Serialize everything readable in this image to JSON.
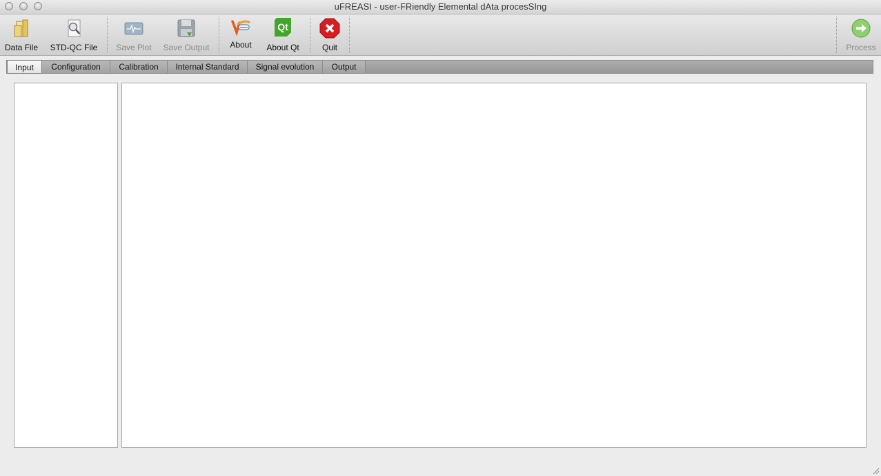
{
  "window": {
    "title": "uFREASI - user-FRiendly Elemental dAta procesSIng"
  },
  "toolbar": {
    "data_file": "Data File",
    "std_qc_file": "STD-QC File",
    "save_plot": "Save Plot",
    "save_output": "Save Output",
    "about": "About",
    "about_qt": "About Qt",
    "quit": "Quit",
    "process": "Process",
    "qt_logo_text": "Qt"
  },
  "tabs": [
    {
      "label": "Input"
    },
    {
      "label": "Configuration"
    },
    {
      "label": "Calibration"
    },
    {
      "label": "Internal Standard"
    },
    {
      "label": "Signal evolution"
    },
    {
      "label": "Output"
    }
  ],
  "colors": {
    "quit_red": "#d91c20",
    "qt_green": "#41a62a",
    "process_green": "#6cbf4a"
  },
  "icons": {
    "data_file": "folder-file-icon",
    "std_qc_file": "magnifier-document-icon",
    "save_plot": "waveform-monitor-icon",
    "save_output": "floppy-disk-icon",
    "about": "app-logo-icon",
    "about_qt": "qt-logo-icon",
    "quit": "stop-icon",
    "process": "arrow-right-circle-icon"
  }
}
